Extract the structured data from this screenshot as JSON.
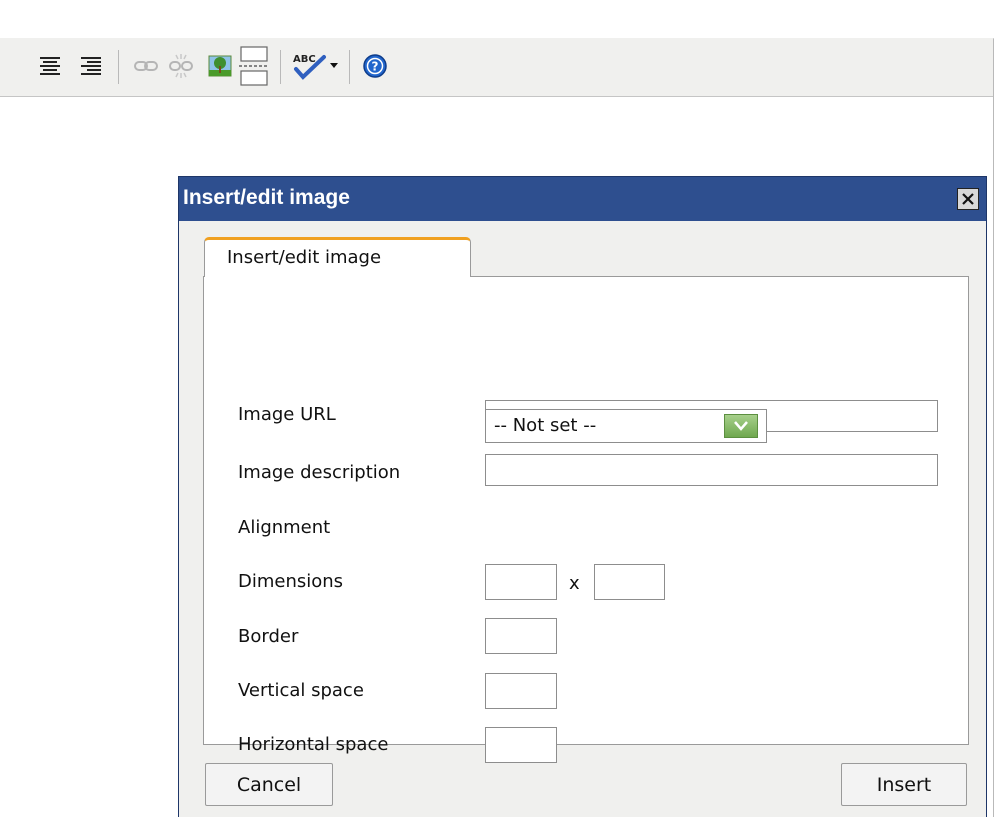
{
  "toolbar": {
    "buttons": [
      {
        "icon": "align-center-icon"
      },
      {
        "icon": "align-right-icon"
      },
      {
        "icon": "link-icon"
      },
      {
        "icon": "unlink-icon"
      },
      {
        "icon": "image-icon"
      },
      {
        "icon": "page-break-icon"
      },
      {
        "icon": "spellcheck-icon",
        "label": "ABC"
      },
      {
        "icon": "help-icon"
      }
    ]
  },
  "dialog": {
    "title": "Insert/edit image",
    "tab_label": "Insert/edit image",
    "fields": {
      "image_url": {
        "label": "Image URL",
        "value": ""
      },
      "image_description": {
        "label": "Image description",
        "value": ""
      },
      "alignment": {
        "label": "Alignment",
        "selected": "-- Not set --"
      },
      "dimensions": {
        "label": "Dimensions",
        "separator": "x",
        "width": "",
        "height": ""
      },
      "border": {
        "label": "Border",
        "value": ""
      },
      "vertical_space": {
        "label": "Vertical space",
        "value": ""
      },
      "horizontal_space": {
        "label": "Horizontal space",
        "value": ""
      }
    },
    "buttons": {
      "cancel": "Cancel",
      "insert": "Insert"
    }
  },
  "colors": {
    "title_bar": "#2e4f8f",
    "tab_accent": "#f0a020",
    "toolbar_bg": "#f0f0ee",
    "help_blue": "#2266cc"
  }
}
